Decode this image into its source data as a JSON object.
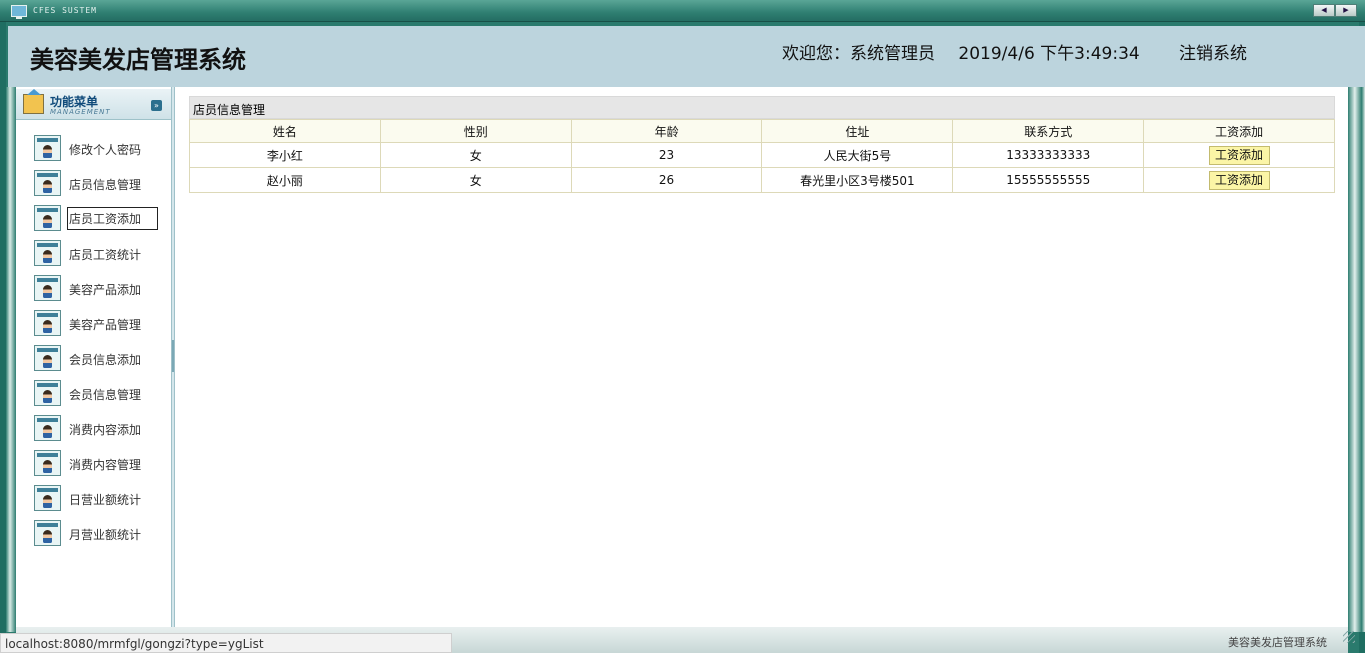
{
  "window": {
    "system_name": "CFES SUSTEM",
    "nav_prev": "◀",
    "nav_next": "▶"
  },
  "header": {
    "app_title": "美容美发店管理系统",
    "welcome": "欢迎您：系统管理员",
    "datetime": "2019/4/6 下午3:49:34",
    "logout_label": "注销系统"
  },
  "sidebar": {
    "head_title": "功能菜单",
    "head_subtitle": "MANAGEMENT",
    "collapse_glyph": "»",
    "items": [
      {
        "label": "修改个人密码"
      },
      {
        "label": "店员信息管理"
      },
      {
        "label": "店员工资添加"
      },
      {
        "label": "店员工资统计"
      },
      {
        "label": "美容产品添加"
      },
      {
        "label": "美容产品管理"
      },
      {
        "label": "会员信息添加"
      },
      {
        "label": "会员信息管理"
      },
      {
        "label": "消费内容添加"
      },
      {
        "label": "消费内容管理"
      },
      {
        "label": "日营业额统计"
      },
      {
        "label": "月营业额统计"
      }
    ]
  },
  "main": {
    "panel_title": "店员信息管理",
    "columns": [
      "姓名",
      "性别",
      "年龄",
      "住址",
      "联系方式",
      "工资添加"
    ],
    "rows": [
      {
        "name": "李小红",
        "gender": "女",
        "age": "23",
        "address": "人民大街5号",
        "phone": "13333333333",
        "action": "工资添加"
      },
      {
        "name": "赵小丽",
        "gender": "女",
        "age": "26",
        "address": "春光里小区3号楼501",
        "phone": "15555555555",
        "action": "工资添加"
      }
    ]
  },
  "footer": {
    "system_name": "美容美发店管理系统",
    "status_url": "localhost:8080/mrmfgl/gongzi?type=ygList"
  }
}
